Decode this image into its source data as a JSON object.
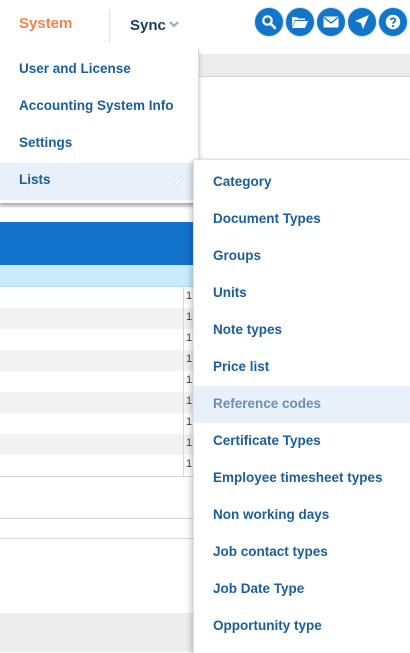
{
  "nav": {
    "system": "System",
    "sync": "Sync",
    "icons": [
      "search-icon",
      "folder-icon",
      "mail-icon",
      "send-icon",
      "help-icon"
    ],
    "accent_color": "#f0834f",
    "icon_color": "#1275c9"
  },
  "system_menu": {
    "items": [
      {
        "label": "User and License"
      },
      {
        "label": "Accounting System Info"
      },
      {
        "label": "Settings"
      },
      {
        "label": "Lists",
        "active": true
      }
    ]
  },
  "lists_submenu": {
    "items": [
      {
        "label": "Category"
      },
      {
        "label": "Document Types"
      },
      {
        "label": "Groups"
      },
      {
        "label": "Units"
      },
      {
        "label": "Note types"
      },
      {
        "label": "Price list"
      },
      {
        "label": "Reference codes",
        "hover": true
      },
      {
        "label": "Certificate Types"
      },
      {
        "label": "Employee timesheet types"
      },
      {
        "label": "Non working days"
      },
      {
        "label": "Job contact types"
      },
      {
        "label": "Job Date Type"
      },
      {
        "label": "Opportunity type"
      }
    ]
  },
  "background_table": {
    "cells": [
      "1",
      "1",
      "1",
      "1",
      "1",
      "1",
      "1",
      "1",
      "1"
    ]
  }
}
